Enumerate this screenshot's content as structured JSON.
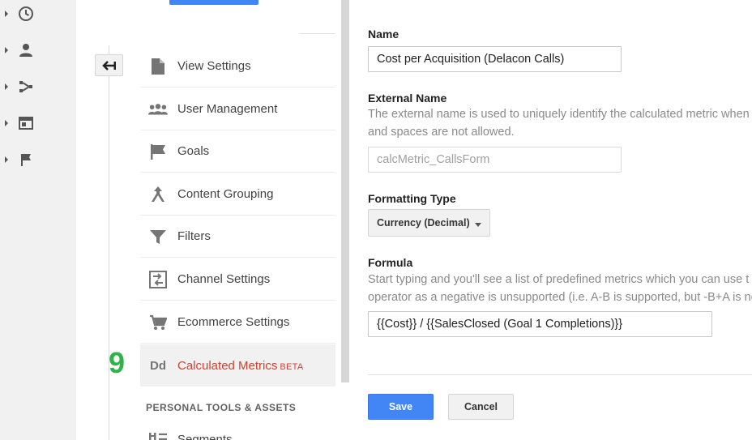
{
  "nav": {
    "items": [
      {
        "label": "View Settings",
        "icon": "document-icon"
      },
      {
        "label": "User Management",
        "icon": "users-icon"
      },
      {
        "label": "Goals",
        "icon": "flag-icon"
      },
      {
        "label": "Content Grouping",
        "icon": "content-grouping-icon"
      },
      {
        "label": "Filters",
        "icon": "filter-icon"
      },
      {
        "label": "Channel Settings",
        "icon": "channel-settings-icon"
      },
      {
        "label": "Ecommerce Settings",
        "icon": "cart-icon"
      },
      {
        "label": "Calculated Metrics",
        "icon": "dd-icon",
        "icon_text": "Dd",
        "badge": "BETA",
        "active": true
      }
    ],
    "section_heading": "PERSONAL TOOLS & ASSETS",
    "partial_item": {
      "label": "Segments",
      "icon": "segments-icon"
    },
    "step_number": "9"
  },
  "form": {
    "name_label": "Name",
    "name_value": "Cost per Acquisition (Delacon Calls)",
    "external_label": "External Name",
    "external_help_line1": "The external name is used to uniquely identify the calculated metric when",
    "external_help_line2": "and spaces are not allowed.",
    "external_value": "calcMetric_CallsForm",
    "formatting_label": "Formatting Type",
    "formatting_value": "Currency (Decimal)",
    "formula_label": "Formula",
    "formula_help_line1": "Start typing and you'll see a list of predefined metrics which you can use t",
    "formula_help_line2": "operator as a negative is unsupported (i.e. A-B is supported, but -B+A is no",
    "formula_value": "{{Cost}} / {{SalesClosed (Goal 1 Completions)}}",
    "save_label": "Save",
    "cancel_label": "Cancel"
  },
  "colors": {
    "accent_blue": "#4285f4",
    "active_red": "#d23f31",
    "step_green": "#2db34a"
  }
}
